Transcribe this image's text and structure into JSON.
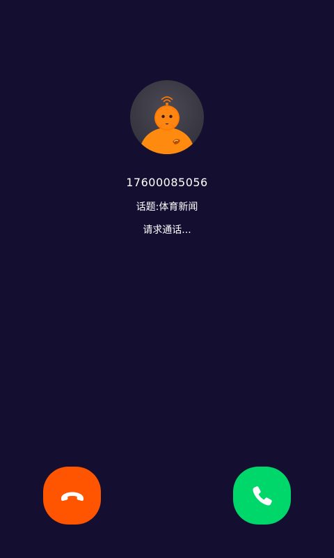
{
  "caller": {
    "phone_number": "17600085056",
    "topic": "话题:体育新闻",
    "status": "请求通话..."
  },
  "actions": {
    "decline": {
      "icon": "hang-up-icon"
    },
    "accept": {
      "icon": "phone-icon"
    }
  },
  "colors": {
    "background": "#140f31",
    "decline": "#ff5500",
    "accept": "#00d76b",
    "avatar_accent": "#ff7a00"
  }
}
